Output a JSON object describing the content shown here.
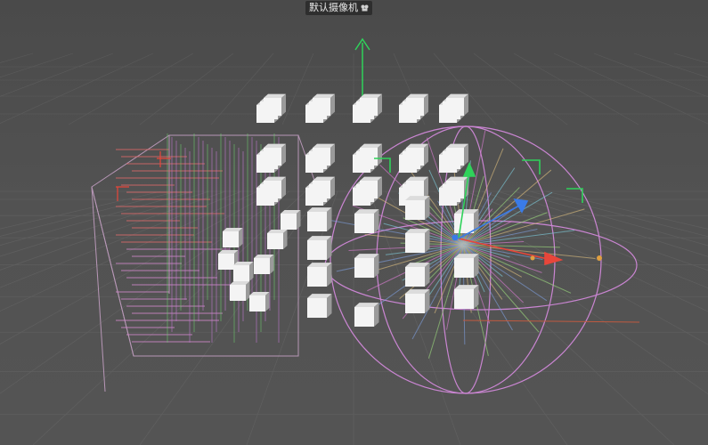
{
  "viewport": {
    "camera_label": "默认摄像机",
    "camera_icon": "camera-icon"
  },
  "colors": {
    "background": "#505050",
    "grid": "#6a6a6a",
    "cube_face": "#f4f4f4",
    "cube_shadow": "#9a9a9a",
    "field_box": "#c9a3c8",
    "sphere_field": "#d78be0",
    "axis_x": "#e8463a",
    "axis_y": "#2fd25a",
    "axis_z": "#3a7be8",
    "world_axis_y": "#2fd25a"
  }
}
